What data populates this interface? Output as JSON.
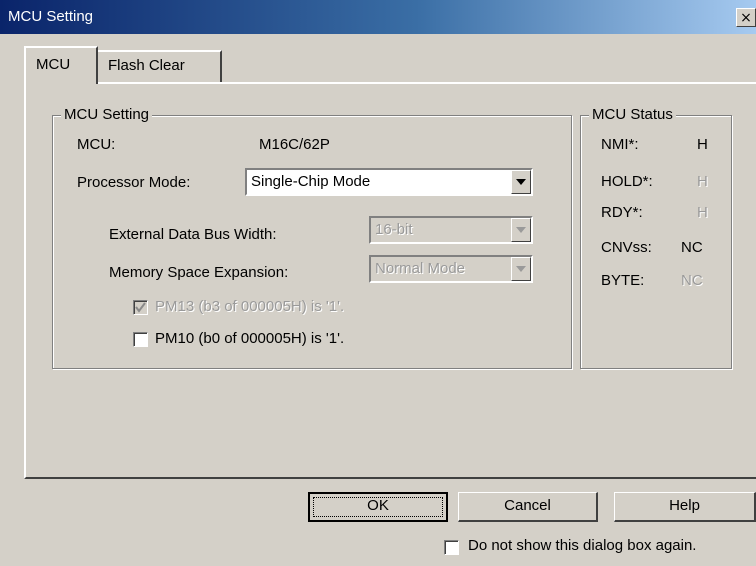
{
  "window": {
    "title": "MCU Setting",
    "close_symbol": "×"
  },
  "tabs": [
    {
      "label": "MCU",
      "active": true
    },
    {
      "label": "Flash Clear",
      "active": false
    }
  ],
  "mcu_setting": {
    "group_label": "MCU Setting",
    "mcu_label": "MCU:",
    "mcu_value": "M16C/62P",
    "processor_mode_label": "Processor Mode:",
    "processor_mode_value": "Single-Chip Mode",
    "ext_bus_label": "External Data Bus Width:",
    "ext_bus_value": "16-bit",
    "mem_expansion_label": "Memory Space Expansion:",
    "mem_expansion_value": "Normal Mode",
    "pm13_label": "PM13 (b3 of 000005H) is '1'.",
    "pm13_checked": true,
    "pm10_label": "PM10 (b0 of 000005H) is '1'.",
    "pm10_checked": false
  },
  "mcu_status": {
    "group_label": "MCU Status",
    "rows": [
      {
        "name": "NMI*:",
        "value": "H",
        "enabled": true
      },
      {
        "name": "HOLD*:",
        "value": "H",
        "enabled": false
      },
      {
        "name": "RDY*:",
        "value": "H",
        "enabled": false
      },
      {
        "name": "CNVss:",
        "value": "NC",
        "enabled": true
      },
      {
        "name": "BYTE:",
        "value": "NC",
        "enabled": false
      }
    ]
  },
  "buttons": {
    "ok": "OK",
    "cancel": "Cancel",
    "help": "Help"
  },
  "footer": {
    "dont_show_label": "Do not show this dialog box again.",
    "dont_show_checked": false
  }
}
